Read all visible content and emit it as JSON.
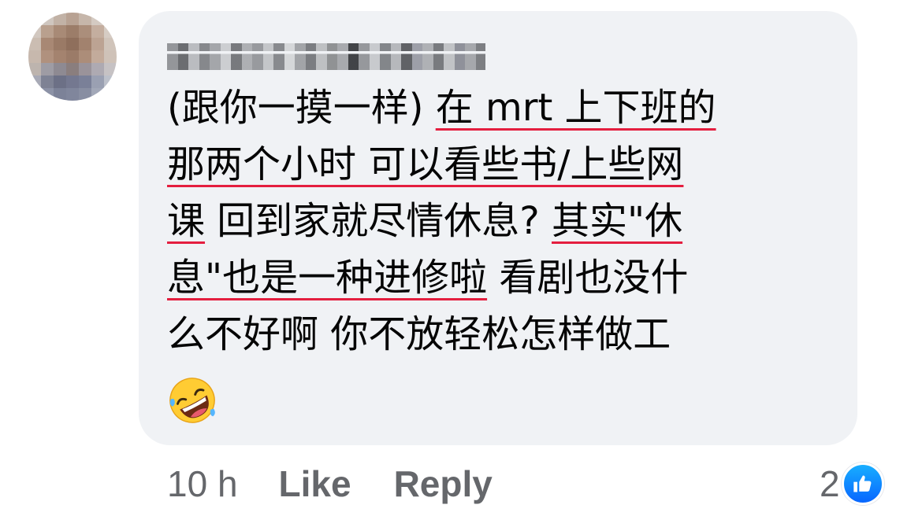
{
  "comment": {
    "author_name": "",
    "text_segments": [
      [
        {
          "text": "(跟你一摸一样) ",
          "underlined": false
        },
        {
          "text": "在 mrt 上下班的",
          "underlined": true
        }
      ],
      [
        {
          "text": "那两个小时 可以看些书/上些网",
          "underlined": true
        }
      ],
      [
        {
          "text": "课",
          "underlined": true
        },
        {
          "text": " 回到家就尽情休息? ",
          "underlined": false
        },
        {
          "text": "其实\"休",
          "underlined": true
        }
      ],
      [
        {
          "text": "息\"也是一种进修啦",
          "underlined": true
        },
        {
          "text": " 看剧也没什",
          "underlined": false
        }
      ],
      [
        {
          "text": "么不好啊 你不放轻松怎样做工",
          "underlined": false
        }
      ]
    ],
    "emoji": "rolling-on-the-floor-laughing-emoji",
    "underline_color": "#e41e3f"
  },
  "actions": {
    "timestamp": "10 h",
    "like_label": "Like",
    "reply_label": "Reply"
  },
  "reactions": {
    "count": "2",
    "type": "like-icon",
    "badge_color": "#0866ff"
  },
  "colors": {
    "bubble_bg": "#f0f2f5",
    "meta_text": "#65676b",
    "text": "#050505"
  }
}
